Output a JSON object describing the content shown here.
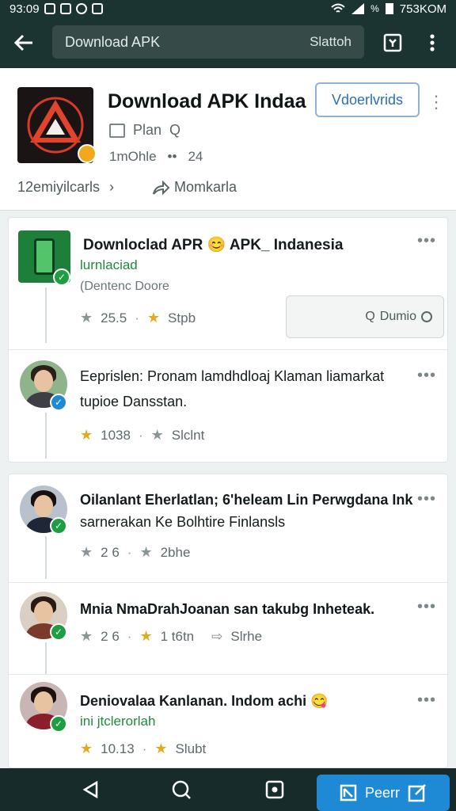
{
  "status_bar": {
    "time": "93:09",
    "battery_pct": "%",
    "right_text": "753KOM"
  },
  "search": {
    "value": "Download APK",
    "action_label": "Slattoh"
  },
  "app": {
    "name": "Download APK Indaa",
    "install_label": "Vdoerlvrids",
    "category": "Plan",
    "developer": "1mOhle",
    "count": "24",
    "reviews_link": "12emiyilcarls",
    "share_label": "Momkarla"
  },
  "posts": [
    {
      "title": "Downloclad APR 😊 APK_ Indanesia",
      "subtitle": "lurnlaciad",
      "description": "(Dentenc Doore",
      "rating": "25.5",
      "secondary": "Stpb",
      "action_label": "Dumio"
    },
    {
      "title": "Eeprislen: Pronam lamdhdloaj Klaman liamarkat",
      "title2": "tupioe Dansstan.",
      "rating": "1038",
      "secondary": "Slclnt"
    },
    {
      "title": "Oilanlant Eherlatlan; 6'heleam Lin Perwgdana Ink",
      "title2": "sarnerakan Ke Bolhtire Finlansls",
      "rating": "2  6",
      "secondary": "2bhe"
    },
    {
      "title": "Mnia NmaDrahJoanan san takubg Inheteak.",
      "rating": "2  6",
      "secondary": "1 t6tn",
      "share_label": "Slrhe"
    },
    {
      "title": "Deniovalaa Kanlanan. Indom achi 😋",
      "subtitle": "ini jtclerorlah",
      "rating": "10.13",
      "secondary": "Slubt"
    }
  ],
  "bottom_nav": {
    "post_label": "Peerr"
  },
  "colors": {
    "topbar": "#1b3431",
    "accent": "#1e8ad6",
    "verified": "#1d9e43",
    "star": "#e6a91c"
  }
}
